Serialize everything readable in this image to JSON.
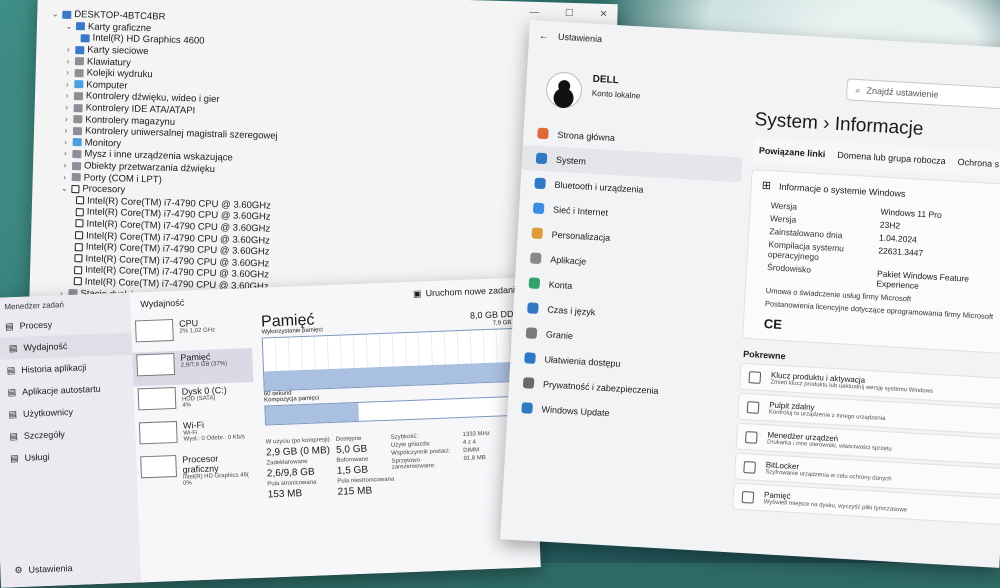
{
  "device_manager": {
    "computer_name": "DESKTOP-4BTC4BR",
    "rows": [
      {
        "label": "Karty graficzne",
        "level": 1,
        "expanded": true,
        "icon": "display-adapter-icon"
      },
      {
        "label": "Intel(R) HD Graphics 4600",
        "level": 2,
        "icon": "display-adapter-icon"
      },
      {
        "label": "Karty sieciowe",
        "level": 1,
        "icon": "network-adapter-icon"
      },
      {
        "label": "Klawiatury",
        "level": 1,
        "icon": "keyboard-icon"
      },
      {
        "label": "Kolejki wydruku",
        "level": 1,
        "icon": "printer-icon"
      },
      {
        "label": "Komputer",
        "level": 1,
        "icon": "computer-icon"
      },
      {
        "label": "Kontrolery dźwięku, wideo i gier",
        "level": 1,
        "icon": "sound-icon"
      },
      {
        "label": "Kontrolery IDE ATA/ATAPI",
        "level": 1,
        "icon": "ide-icon"
      },
      {
        "label": "Kontrolery magazynu",
        "level": 1,
        "icon": "storage-icon"
      },
      {
        "label": "Kontrolery uniwersalnej magistrali szeregowej",
        "level": 1,
        "icon": "usb-icon"
      },
      {
        "label": "Monitory",
        "level": 1,
        "icon": "monitor-icon"
      },
      {
        "label": "Mysz i inne urządzenia wskazujące",
        "level": 1,
        "icon": "mouse-icon"
      },
      {
        "label": "Obiekty przetwarzania dźwięku",
        "level": 1,
        "icon": "audio-icon"
      },
      {
        "label": "Porty (COM i LPT)",
        "level": 1,
        "icon": "port-icon"
      },
      {
        "label": "Procesory",
        "level": 1,
        "expanded": true,
        "icon": "cpu-icon"
      },
      {
        "label": "Intel(R) Core(TM) i7-4790 CPU @ 3.60GHz",
        "level": 2,
        "icon": "cpu-icon"
      },
      {
        "label": "Intel(R) Core(TM) i7-4790 CPU @ 3.60GHz",
        "level": 2,
        "icon": "cpu-icon"
      },
      {
        "label": "Intel(R) Core(TM) i7-4790 CPU @ 3.60GHz",
        "level": 2,
        "icon": "cpu-icon"
      },
      {
        "label": "Intel(R) Core(TM) i7-4790 CPU @ 3.60GHz",
        "level": 2,
        "icon": "cpu-icon"
      },
      {
        "label": "Intel(R) Core(TM) i7-4790 CPU @ 3.60GHz",
        "level": 2,
        "icon": "cpu-icon"
      },
      {
        "label": "Intel(R) Core(TM) i7-4790 CPU @ 3.60GHz",
        "level": 2,
        "icon": "cpu-icon"
      },
      {
        "label": "Intel(R) Core(TM) i7-4790 CPU @ 3.60GHz",
        "level": 2,
        "icon": "cpu-icon"
      },
      {
        "label": "Intel(R) Core(TM) i7-4790 CPU @ 3.60GHz",
        "level": 2,
        "icon": "cpu-icon"
      },
      {
        "label": "Stacje dysków",
        "level": 1,
        "icon": "disk-icon"
      }
    ]
  },
  "task_manager": {
    "app_title": "Menedżer zadań",
    "nav": [
      {
        "label": "Procesy",
        "icon": "grid-icon"
      },
      {
        "label": "Wydajność",
        "icon": "performance-icon",
        "active": true
      },
      {
        "label": "Historia aplikacji",
        "icon": "history-icon"
      },
      {
        "label": "Aplikacje autostartu",
        "icon": "startup-icon"
      },
      {
        "label": "Użytkownicy",
        "icon": "users-icon"
      },
      {
        "label": "Szczegóły",
        "icon": "details-icon"
      },
      {
        "label": "Usługi",
        "icon": "services-icon"
      }
    ],
    "settings_label": "Ustawienia",
    "section_title": "Wydajność",
    "run_task": "Uruchom nowe zadanie",
    "resources": [
      {
        "name": "CPU",
        "sub": "2% 1,02 GHz"
      },
      {
        "name": "Pamięć",
        "sub": "2,9/7,9 GB (37%)",
        "selected": true
      },
      {
        "name": "Dysk 0 (C:)",
        "sub": "HDD (SATA)",
        "sub2": "4%"
      },
      {
        "name": "Wi-Fi",
        "sub": "Wi-Fi",
        "sub2": "Wysł.: 0 Odebr.: 0 Kb/s"
      },
      {
        "name": "Procesor graficzny",
        "sub": "Intel(R) HD Graphics 46(",
        "sub2": "0%"
      }
    ],
    "memory": {
      "title": "Pamięć",
      "capacity": "8,0 GB DDR3",
      "usage_label": "Wykorzystanie pamięci",
      "usage_max": "7,9 GB",
      "seconds": "60 sekund",
      "composition": "Kompozycja pamięci",
      "usage_fraction": 0.37,
      "stats": [
        {
          "k": "W użyciu (po kompresji)",
          "v": "2,9 GB (0 MB)"
        },
        {
          "k": "Dostępne",
          "v": "5,0 GB"
        },
        {
          "k": "Zadeklarowane",
          "v": "2,6/9,8 GB"
        },
        {
          "k": "Buforowane",
          "v": "1,5 GB"
        },
        {
          "k": "Pula stronicowana",
          "v": "153 MB"
        },
        {
          "k": "Pula niestronicowana",
          "v": "215 MB"
        }
      ],
      "stats2": [
        {
          "k": "Szybkość:",
          "v": "1333 MHz"
        },
        {
          "k": "Użyte gniazda:",
          "v": "4 z 4"
        },
        {
          "k": "Współczynnik postaci:",
          "v": "DIMM"
        },
        {
          "k": "Sprzętowo zarezerwowane:",
          "v": "91,8 MB"
        }
      ]
    }
  },
  "settings": {
    "app_title": "Ustawienia",
    "user_name": "DELL",
    "user_sub": "Konto lokalne",
    "search_placeholder": "Znajdź ustawienie",
    "nav": [
      {
        "label": "Strona główna",
        "icon": "home-icon",
        "color": "#e0693a"
      },
      {
        "label": "System",
        "icon": "system-icon",
        "color": "#2f78c4",
        "active": true
      },
      {
        "label": "Bluetooth i urządzenia",
        "icon": "bluetooth-icon",
        "color": "#2f78c4"
      },
      {
        "label": "Sieć i Internet",
        "icon": "wifi-icon",
        "color": "#3a8de0"
      },
      {
        "label": "Personalizacja",
        "icon": "brush-icon",
        "color": "#e09a3a"
      },
      {
        "label": "Aplikacje",
        "icon": "apps-icon",
        "color": "#8a8a8a"
      },
      {
        "label": "Konta",
        "icon": "account-icon",
        "color": "#2fa36b"
      },
      {
        "label": "Czas i język",
        "icon": "globe-icon",
        "color": "#2f78c4"
      },
      {
        "label": "Granie",
        "icon": "gaming-icon",
        "color": "#7a7a7a"
      },
      {
        "label": "Ułatwienia dostępu",
        "icon": "accessibility-icon",
        "color": "#2f78c4"
      },
      {
        "label": "Prywatność i zabezpieczenia",
        "icon": "shield-icon",
        "color": "#6a6a6a"
      },
      {
        "label": "Windows Update",
        "icon": "update-icon",
        "color": "#2f78c4"
      }
    ],
    "breadcrumb_1": "System",
    "breadcrumb_sep": "›",
    "breadcrumb_2": "Informacje",
    "related": [
      "Powiązane linki",
      "Domena lub grupa robocza",
      "Ochrona s"
    ],
    "windows_card_title": "Informacje o systemie Windows",
    "windows_info": [
      {
        "k": "Wersja",
        "v": "Windows 11 Pro"
      },
      {
        "k": "Wersja",
        "v": "23H2"
      },
      {
        "k": "Zainstalowano dnia",
        "v": "1.04.2024"
      },
      {
        "k": "Kompilacja systemu operacyjnego",
        "v": "22631.3447"
      },
      {
        "k": "Środowisko",
        "v": "Pakiet Windows Feature Experience"
      }
    ],
    "agreement_1": "Umowa o świadczenie usług firmy Microsoft",
    "agreement_2": "Postanowienia licencyjne dotyczące oprogramowania firmy Microsoft",
    "ce_mark": "CE",
    "support_header": "Pokrewne",
    "support_items": [
      {
        "title": "Klucz produktu i aktywacja",
        "sub": "Zmień klucz produktu lub uaktualnij wersję systemu Windows"
      },
      {
        "title": "Pulpit zdalny",
        "sub": "Kontroluj to urządzenie z innego urządzenia"
      },
      {
        "title": "Menedżer urządzeń",
        "sub": "Drukarka i inne sterowniki, właściwości sprzętu"
      },
      {
        "title": "BitLocker",
        "sub": "Szyfrowanie urządzenia w celu ochrony danych"
      },
      {
        "title": "Pamięć",
        "sub": "Wyświetl miejsce na dysku, wyczyść pliki tymczasowe"
      }
    ]
  }
}
